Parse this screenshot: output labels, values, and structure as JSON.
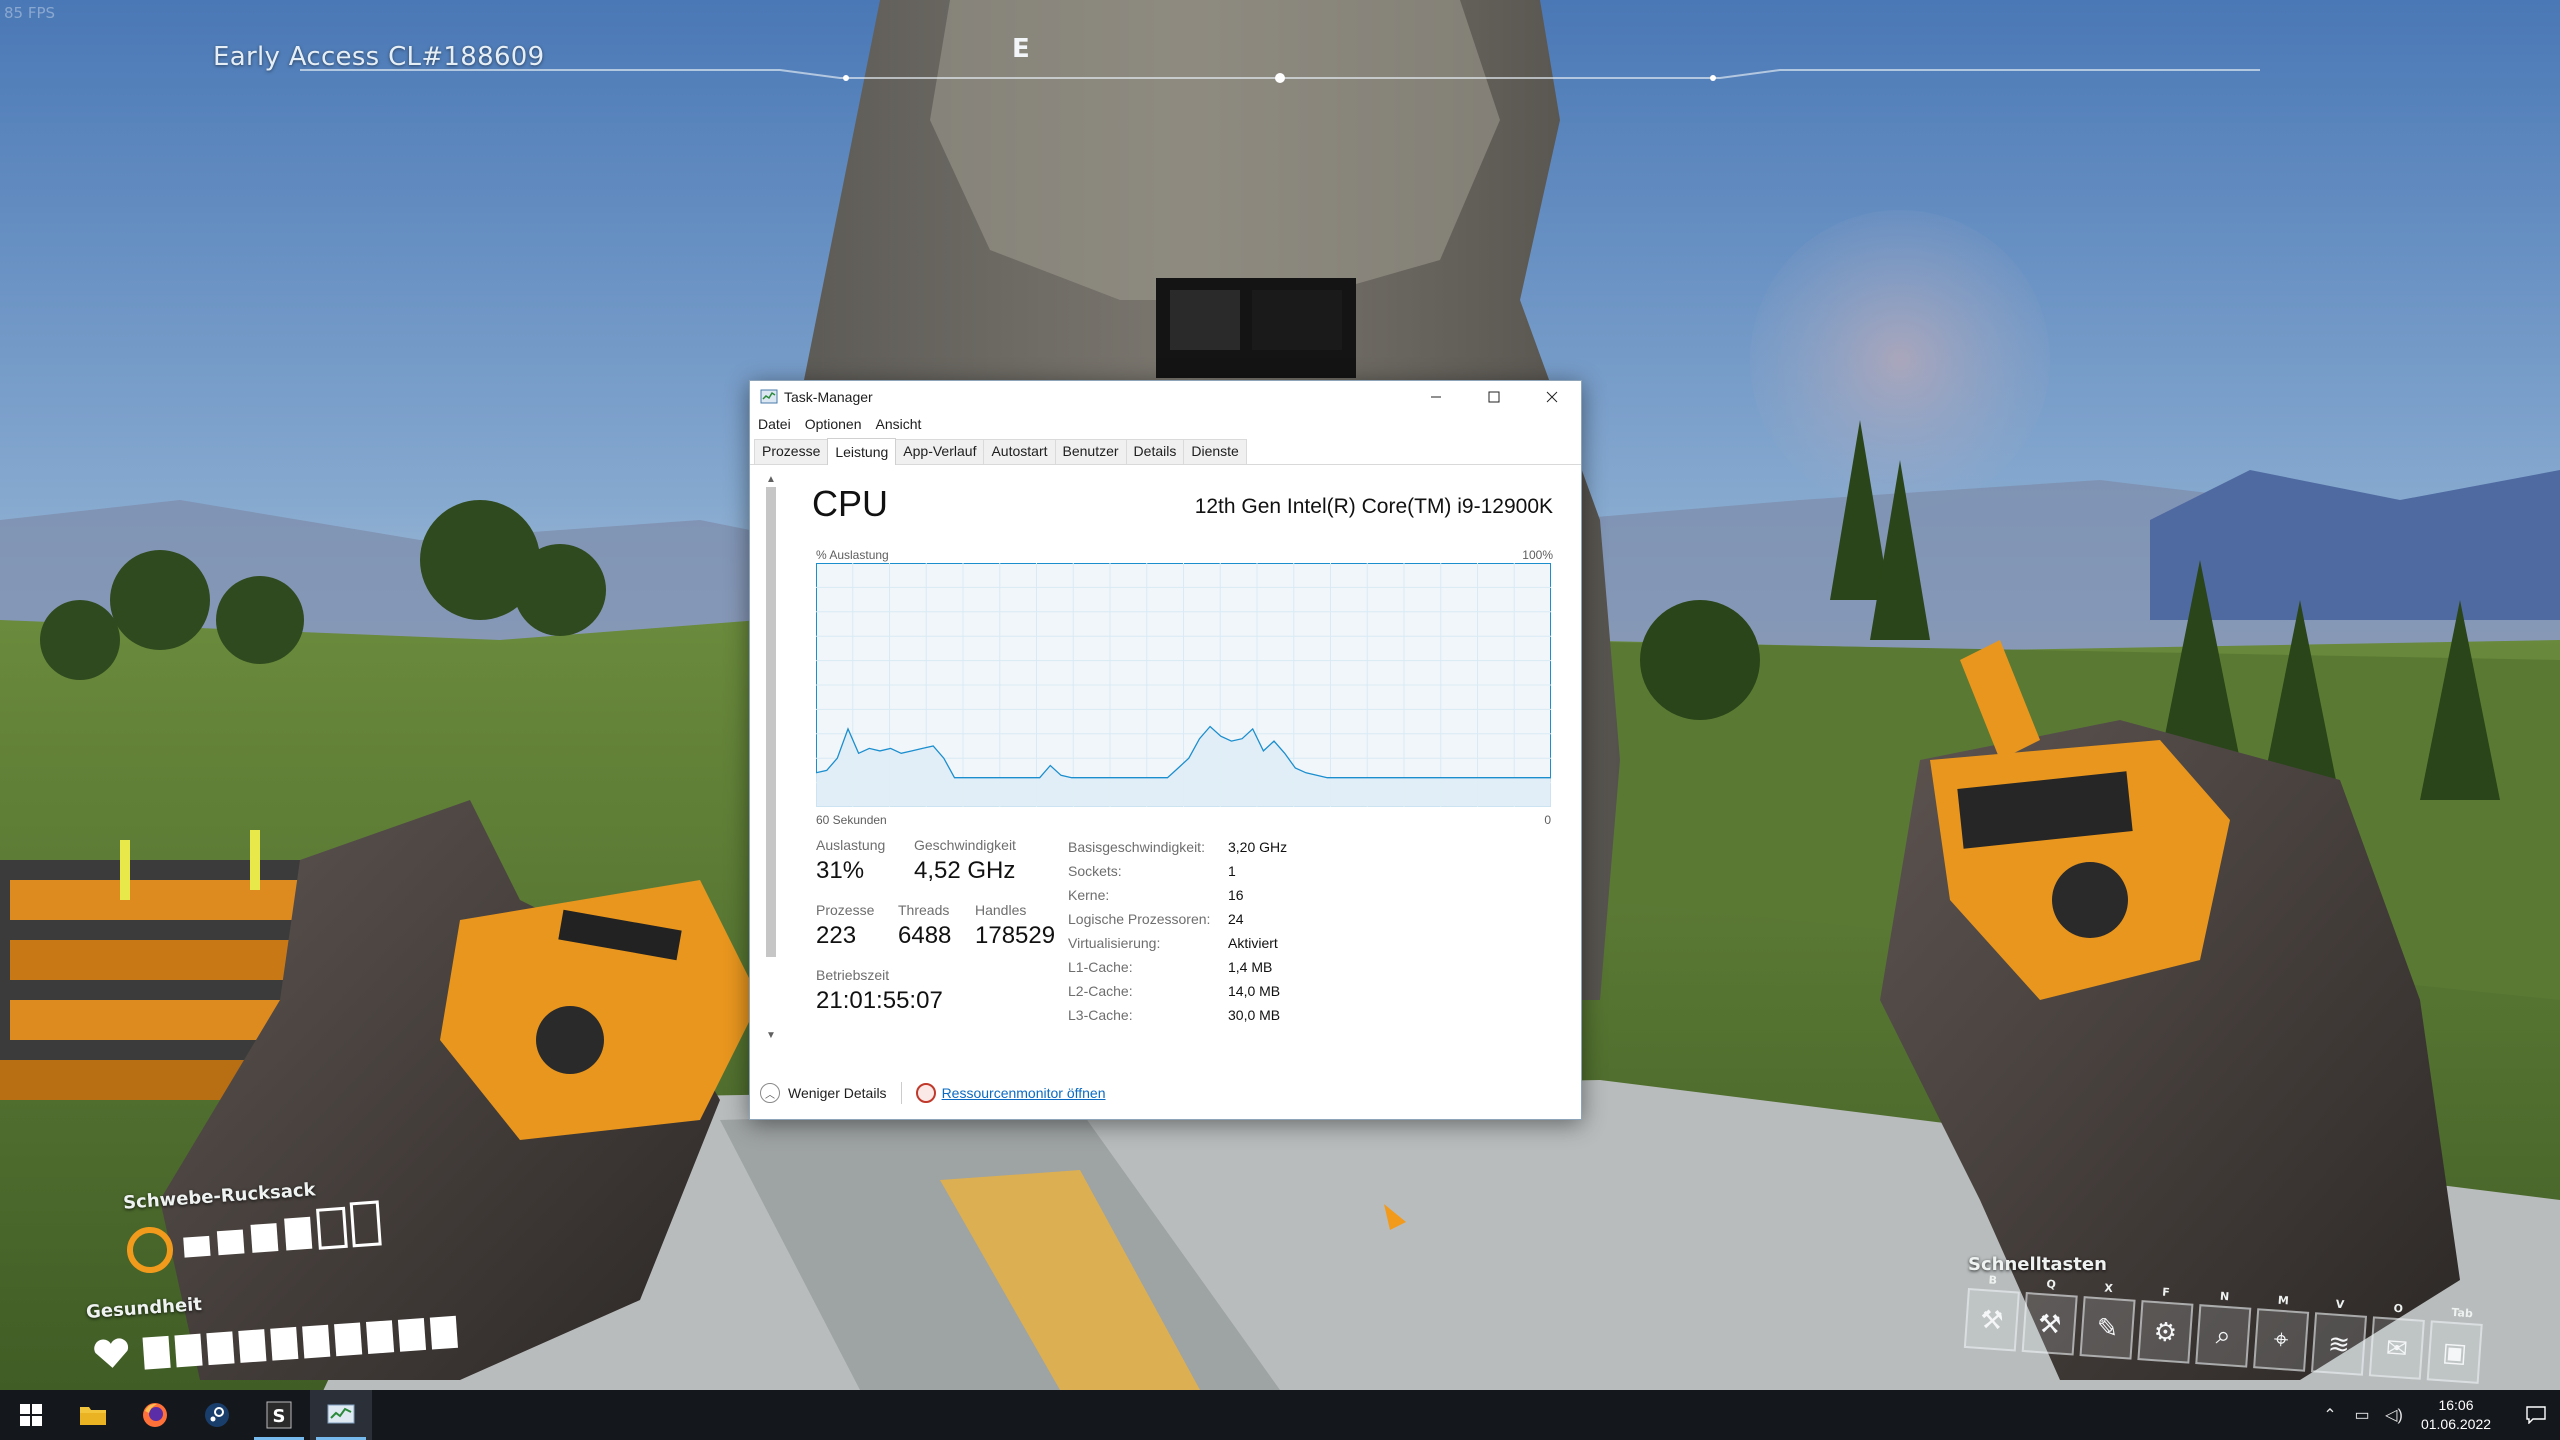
{
  "game": {
    "fps": "85 FPS",
    "build": "Early Access CL#188609",
    "compass_letter": "E",
    "hud": {
      "jetpack_label": "Schwebe-Rucksack",
      "health_label": "Gesundheit",
      "quickbar_label": "Schnelltasten",
      "quickbar_keys": [
        "B",
        "Q",
        "X",
        "F",
        "N",
        "M",
        "V",
        "O",
        "Tab"
      ]
    }
  },
  "taskmanager": {
    "title": "Task-Manager",
    "menu": [
      "Datei",
      "Optionen",
      "Ansicht"
    ],
    "tabs": [
      "Prozesse",
      "Leistung",
      "App-Verlauf",
      "Autostart",
      "Benutzer",
      "Details",
      "Dienste"
    ],
    "selected_tab": "Leistung",
    "cpu": {
      "title": "CPU",
      "model": "12th Gen Intel(R) Core(TM) i9-12900K",
      "graph_label_left": "% Auslastung",
      "graph_label_right": "100%",
      "graph_foot_left": "60 Sekunden",
      "graph_foot_right": "0",
      "stats": {
        "auslastung_label": "Auslastung",
        "auslastung": "31%",
        "geschwindigkeit_label": "Geschwindigkeit",
        "geschwindigkeit": "4,52 GHz",
        "prozesse_label": "Prozesse",
        "prozesse": "223",
        "threads_label": "Threads",
        "threads": "6488",
        "handles_label": "Handles",
        "handles": "178529",
        "betriebszeit_label": "Betriebszeit",
        "betriebszeit": "21:01:55:07"
      },
      "specs": [
        {
          "k": "Basisgeschwindigkeit:",
          "v": "3,20 GHz"
        },
        {
          "k": "Sockets:",
          "v": "1"
        },
        {
          "k": "Kerne:",
          "v": "16"
        },
        {
          "k": "Logische Prozessoren:",
          "v": "24"
        },
        {
          "k": "Virtualisierung:",
          "v": "Aktiviert"
        },
        {
          "k": "L1-Cache:",
          "v": "1,4 MB"
        },
        {
          "k": "L2-Cache:",
          "v": "14,0 MB"
        },
        {
          "k": "L3-Cache:",
          "v": "30,0 MB"
        }
      ]
    },
    "footer": {
      "less_details": "Weniger Details",
      "resource_monitor": "Ressourcenmonitor öffnen"
    }
  },
  "cpu_usage_history": [
    14,
    15,
    20,
    32,
    22,
    24,
    23,
    24,
    22,
    23,
    24,
    25,
    20,
    12,
    12,
    12,
    12,
    12,
    12,
    12,
    12,
    12,
    17,
    13,
    12,
    12,
    12,
    12,
    12,
    12,
    12,
    12,
    12,
    12,
    16,
    20,
    28,
    33,
    29,
    27,
    28,
    32,
    23,
    27,
    22,
    16,
    14,
    13,
    12,
    12,
    12,
    12,
    12,
    12,
    12,
    12,
    12,
    12,
    12,
    12,
    12,
    12,
    12,
    12,
    12,
    12,
    12,
    12,
    12,
    12
  ],
  "taskbar": {
    "apps": [
      "start-button",
      "file-explorer",
      "firefox",
      "steam",
      "satisfactory",
      "task-manager"
    ],
    "time": "16:06",
    "date": "01.06.2022"
  },
  "colors": {
    "graph_line": "#1b8ece",
    "graph_fill": "#f1f6fa",
    "graph_grid": "#d9eaf4",
    "link": "#0a6ac2",
    "accent": "#f29a1c"
  }
}
